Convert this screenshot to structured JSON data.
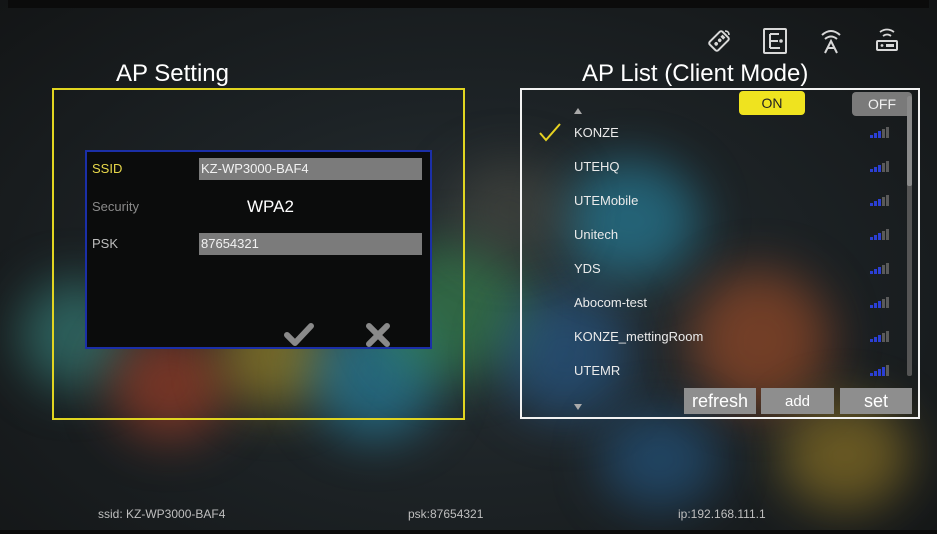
{
  "ap_setting": {
    "title": "AP Setting",
    "fields": [
      {
        "label": "SSID",
        "value": "KZ-WP3000-BAF4",
        "label_color": "#e8d84a"
      },
      {
        "label": "Security",
        "value": "WPA2",
        "label_color": "#8a8a8a"
      },
      {
        "label": "PSK",
        "value": "87654321",
        "label_color": "#bdbdbd"
      }
    ],
    "confirm_icon": "checkmark-icon",
    "cancel_icon": "close-icon"
  },
  "ap_list": {
    "title": "AP List (Client Mode)",
    "toggle_on_label": "ON",
    "toggle_off_label": "OFF",
    "networks": [
      {
        "name": "KONZE",
        "selected": true,
        "signal": 3
      },
      {
        "name": "UTEHQ",
        "selected": false,
        "signal": 3
      },
      {
        "name": "UTEMobile",
        "selected": false,
        "signal": 3
      },
      {
        "name": "Unitech",
        "selected": false,
        "signal": 3
      },
      {
        "name": "YDS",
        "selected": false,
        "signal": 3
      },
      {
        "name": "Abocom-test",
        "selected": false,
        "signal": 3
      },
      {
        "name": "KONZE_mettingRoom",
        "selected": false,
        "signal": 3
      },
      {
        "name": "UTEMR",
        "selected": false,
        "signal": 4
      }
    ],
    "refresh_label": "refresh",
    "add_label": "add",
    "set_label": "set"
  },
  "top_icons": [
    "remote-icon",
    "network-settings-icon",
    "wireless-antenna-icon",
    "router-icon"
  ],
  "status": {
    "ssid": "ssid: KZ-WP3000-BAF4",
    "psk": "psk:87654321",
    "ip": "ip:192.168.111.1"
  },
  "colors": {
    "accent_yellow": "#e1d520",
    "dialog_border": "#1b2fa8",
    "signal_on": "#2b3fd4",
    "signal_off": "#5a5a5a"
  }
}
